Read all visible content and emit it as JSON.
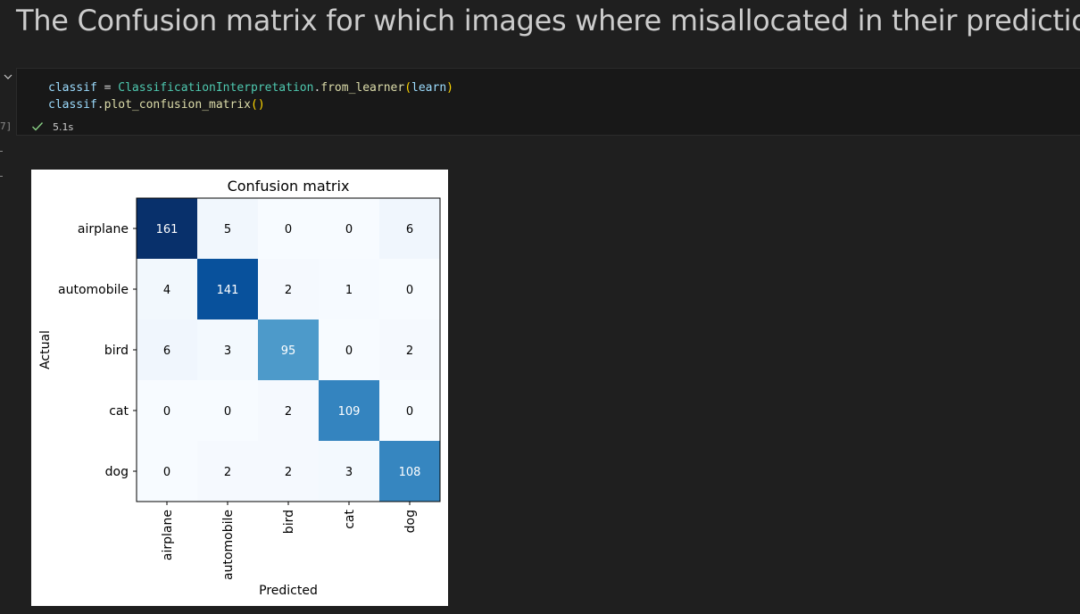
{
  "markdown": {
    "heading": "The Confusion matrix for which images where misallocated in their predictions"
  },
  "cell": {
    "execution_count": "7]",
    "code": {
      "line1": {
        "var": "classif",
        "op": " = ",
        "cls": "ClassificationInterpretation",
        "dot": ".",
        "fn": "from_learner",
        "open": "(",
        "arg": "learn",
        "close": ")"
      },
      "line2": {
        "var": "classif",
        "dot": ".",
        "fn": "plot_confusion_matrix",
        "parens": "()"
      }
    },
    "status": {
      "icon": "check-icon",
      "duration": "5.1s",
      "color": "#89d185"
    }
  },
  "colors": {
    "editor_bg": "#1f1f1f",
    "cell_bg": "#181818",
    "cmap": "Blues"
  },
  "chart_data": {
    "type": "heatmap",
    "title": "Confusion matrix",
    "xlabel": "Predicted",
    "ylabel": "Actual",
    "x_categories": [
      "airplane",
      "automobile",
      "bird",
      "cat",
      "dog"
    ],
    "y_categories": [
      "airplane",
      "automobile",
      "bird",
      "cat",
      "dog"
    ],
    "values": [
      [
        161,
        5,
        0,
        0,
        6
      ],
      [
        4,
        141,
        2,
        1,
        0
      ],
      [
        6,
        3,
        95,
        0,
        2
      ],
      [
        0,
        0,
        2,
        109,
        0
      ],
      [
        0,
        2,
        2,
        3,
        108
      ]
    ],
    "colormap": "Blues",
    "value_range": [
      0,
      161
    ]
  }
}
